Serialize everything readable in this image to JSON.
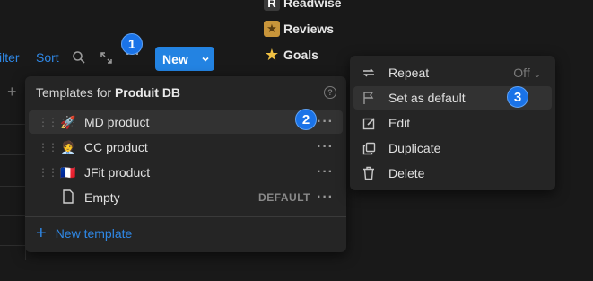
{
  "sidebar_pages": [
    {
      "label": "Readwise",
      "icon": "readwise-icon"
    },
    {
      "label": "Reviews",
      "icon": "folder-star-icon"
    },
    {
      "label": "Goals",
      "icon": "star-icon"
    }
  ],
  "toolbar": {
    "filter_label": "ilter",
    "sort_label": "Sort",
    "new_label": "New"
  },
  "badges": [
    "1",
    "2",
    "3"
  ],
  "templates_popup": {
    "title_prefix": "Templates for ",
    "db_name": "Produit DB",
    "items": [
      {
        "name": "MD product",
        "icon": "🚀"
      },
      {
        "name": "CC product",
        "icon": "🧑‍💼"
      },
      {
        "name": "JFit product",
        "icon": "🇫🇷"
      },
      {
        "name": "Empty",
        "icon": "📄",
        "badge": "DEFAULT"
      }
    ],
    "new_template_label": "New template"
  },
  "context_menu": {
    "items": [
      {
        "label": "Repeat",
        "value": "Off",
        "icon": "repeat-icon"
      },
      {
        "label": "Set as default",
        "icon": "flag-icon"
      },
      {
        "label": "Edit",
        "icon": "edit-icon"
      },
      {
        "label": "Duplicate",
        "icon": "duplicate-icon"
      },
      {
        "label": "Delete",
        "icon": "trash-icon"
      }
    ]
  },
  "colors": {
    "background": "#191919",
    "panel": "#252525",
    "accent": "#2383e2",
    "badge": "#1a73e8"
  }
}
